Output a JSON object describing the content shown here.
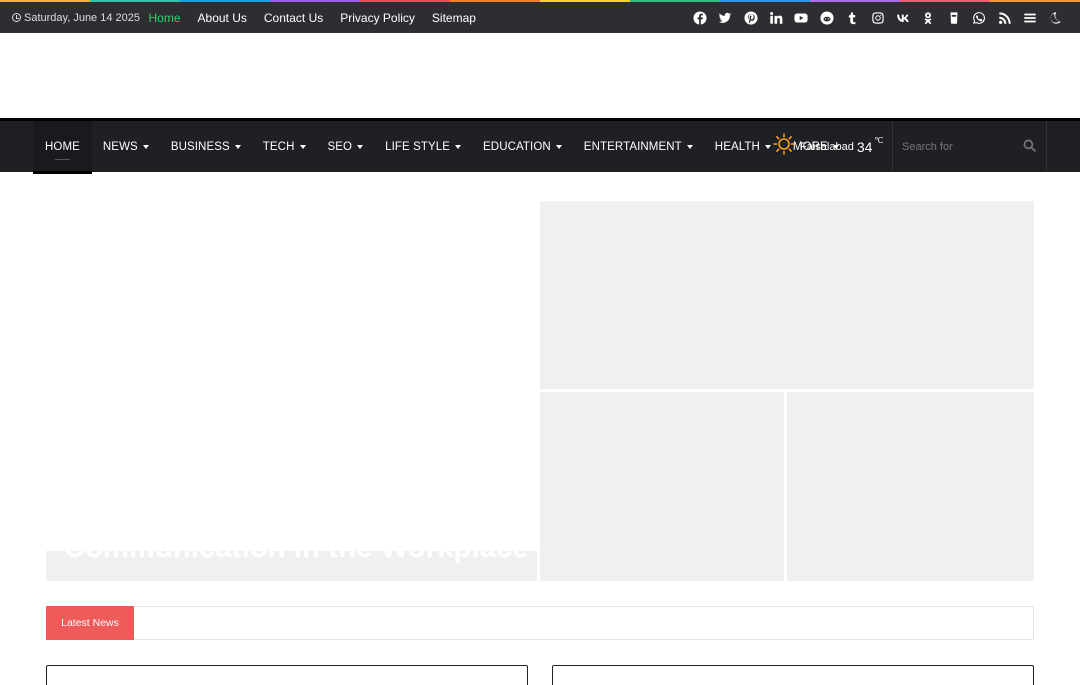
{
  "rainbow_colors": [
    "#f0b331",
    "#35c0a5",
    "#1e9ddc",
    "#9b5de5",
    "#ee4a5a",
    "#f27f2c",
    "#f7d331",
    "#33c17f",
    "#2d95e2",
    "#a96ee7",
    "#f25a70",
    "#ef9a3b"
  ],
  "topbar": {
    "date": "Saturday, June 14 2025",
    "links": [
      {
        "label": "Home",
        "active": true
      },
      {
        "label": "About Us"
      },
      {
        "label": "Contact Us"
      },
      {
        "label": "Privacy Policy"
      },
      {
        "label": "Sitemap"
      }
    ],
    "social_icons": [
      "facebook-icon",
      "twitter-icon",
      "pinterest-icon",
      "linkedin-icon",
      "youtube-icon",
      "reddit-icon",
      "tumblr-icon",
      "instagram-icon",
      "vk-icon",
      "odnoklassniki-icon",
      "untappd-icon",
      "whatsapp-icon",
      "rss-icon",
      "menu-icon",
      "dark-mode-icon"
    ]
  },
  "nav": {
    "items": [
      {
        "label": "HOME",
        "dropdown": false
      },
      {
        "label": "NEWS",
        "dropdown": true
      },
      {
        "label": "BUSINESS",
        "dropdown": true
      },
      {
        "label": "TECH",
        "dropdown": true
      },
      {
        "label": "SEO",
        "dropdown": true
      },
      {
        "label": "LIFE STYLE",
        "dropdown": true
      },
      {
        "label": "EDUCATION",
        "dropdown": true
      },
      {
        "label": "ENTERTAINMENT",
        "dropdown": true
      },
      {
        "label": "HEALTH",
        "dropdown": true
      },
      {
        "label": "MORE",
        "dropdown": true
      }
    ],
    "weather": {
      "location": "Faisalabad",
      "temp": "34",
      "unit": "℃"
    },
    "search_placeholder": "Search for"
  },
  "hero": {
    "main_title": "Communication in the Workplace"
  },
  "ticker": {
    "label": "Latest News"
  },
  "colors": {
    "accent": "#ef5a5a",
    "topbar_bg": "#2c2e32",
    "nav_bg": "#1f2024",
    "active_link": "#33d16a"
  }
}
